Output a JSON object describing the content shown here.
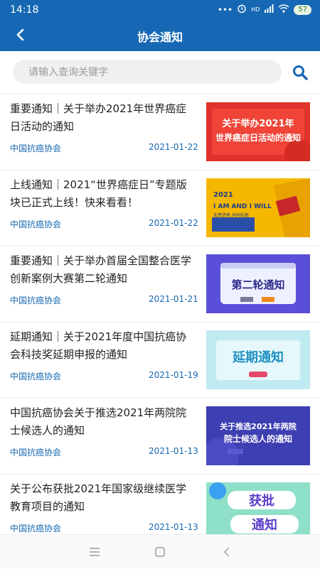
{
  "status": {
    "time": "14:18",
    "signal_label": "HD",
    "battery": "57"
  },
  "header": {
    "title": "协会通知"
  },
  "search": {
    "placeholder": "请输入查询关键字"
  },
  "items": [
    {
      "title": "重要通知｜关于举办2021年世界癌症日活动的通知",
      "source": "中国抗癌协会",
      "date": "2021-01-22",
      "thumb": {
        "line1": "关于举办2021年",
        "line2": "世界癌症日活动的通知"
      }
    },
    {
      "title": "上线通知｜2021“世界癌症日”专题版块已正式上线！快来看看！",
      "source": "中国抗癌协会",
      "date": "2021-01-22",
      "thumb": {
        "line1": "2021",
        "line2": "I AM AND I WILL",
        "line3": "无畏逆者,共同抗癌"
      }
    },
    {
      "title": "重要通知｜关于举办首届全国整合医学创新案例大赛第二轮通知",
      "source": "中国抗癌协会",
      "date": "2021-01-21",
      "thumb": {
        "line1": "第二轮通知"
      }
    },
    {
      "title": "延期通知｜关于2021年度中国抗癌协会科技奖延期申报的通知",
      "source": "中国抗癌协会",
      "date": "2021-01-19",
      "thumb": {
        "line1": "延期通知"
      }
    },
    {
      "title": "中国抗癌协会关于推选2021年两院院士候选人的通知",
      "source": "中国抗癌协会",
      "date": "2021-01-13",
      "thumb": {
        "line1": "关于推选2021年两院",
        "line2": "院士候选人的通知"
      }
    },
    {
      "title": "关于公布获批2021年国家级继续医学教育项目的通知",
      "source": "中国抗癌协会",
      "date": "2021-01-13",
      "thumb": {
        "line1": "获批",
        "line2": "通知"
      }
    }
  ]
}
